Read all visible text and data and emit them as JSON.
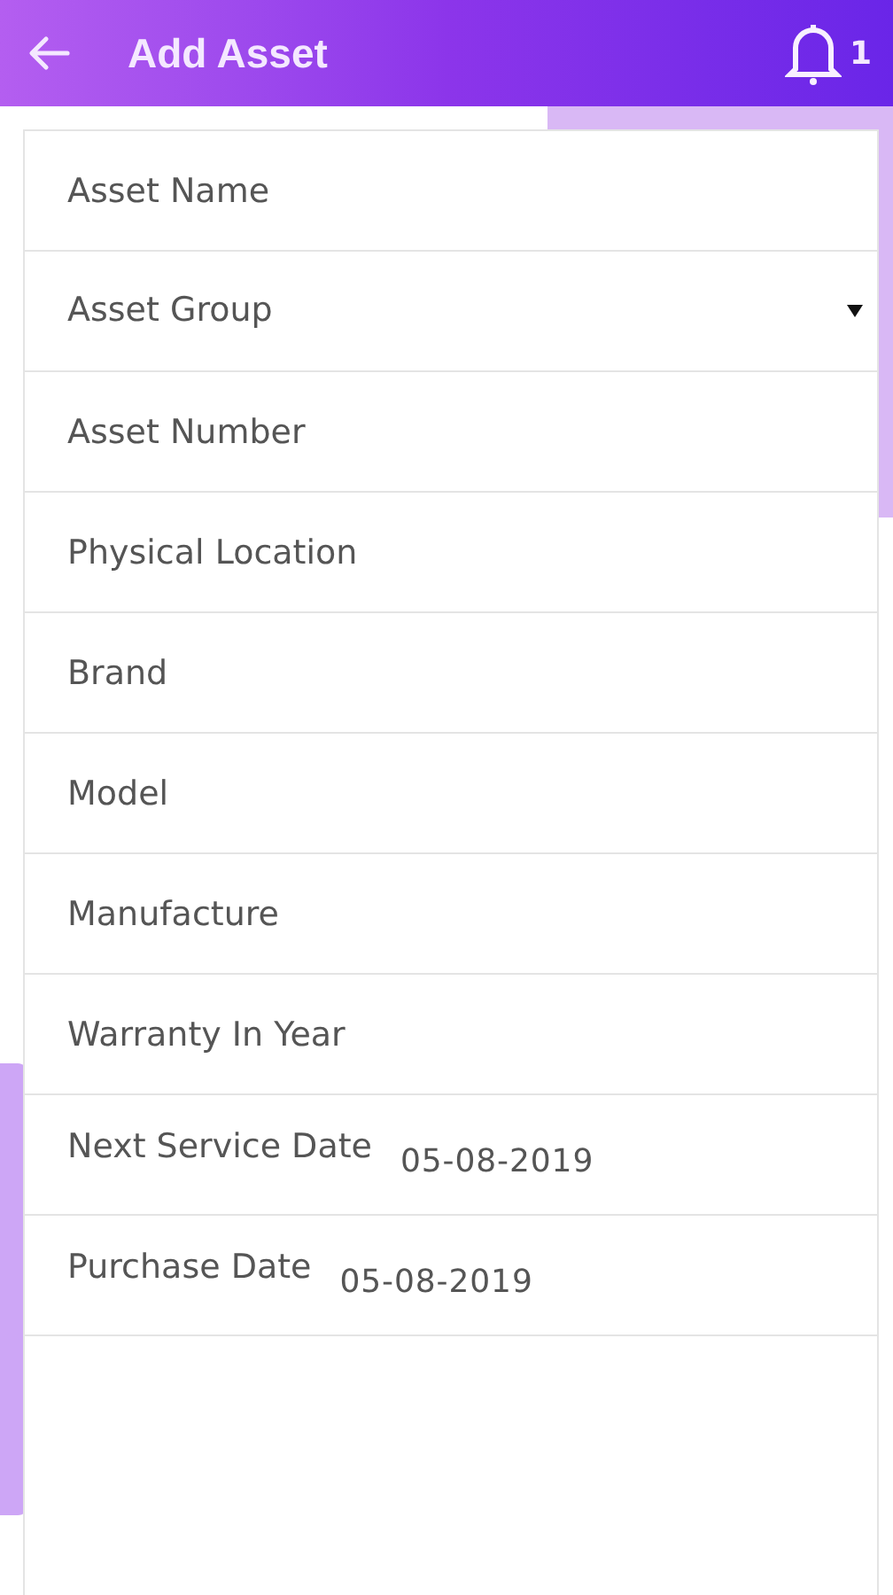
{
  "header": {
    "title": "Add Asset",
    "notification_count": "1"
  },
  "fields": [
    {
      "kind": "text",
      "placeholder": "Asset Name"
    },
    {
      "kind": "select",
      "placeholder": "Asset Group"
    },
    {
      "kind": "text",
      "placeholder": "Asset Number"
    },
    {
      "kind": "text",
      "placeholder": "Physical Location"
    },
    {
      "kind": "text",
      "placeholder": "Brand"
    },
    {
      "kind": "text",
      "placeholder": "Model"
    },
    {
      "kind": "text",
      "placeholder": "Manufacture"
    },
    {
      "kind": "text",
      "placeholder": "Warranty In Year"
    },
    {
      "kind": "date",
      "label": "Next Service Date",
      "value": "05-08-2019"
    },
    {
      "kind": "date",
      "label": "Purchase Date",
      "value": "05-08-2019"
    }
  ]
}
